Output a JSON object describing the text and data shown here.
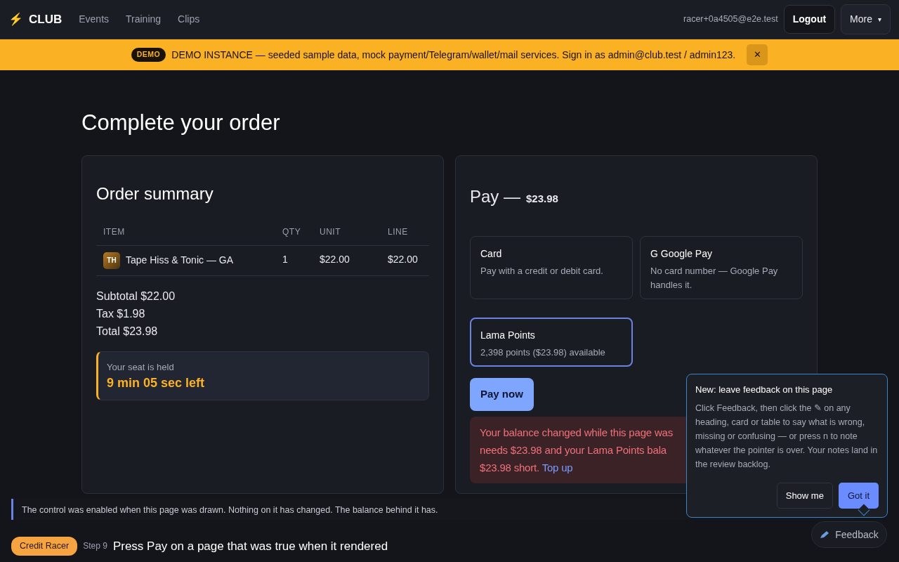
{
  "navbar": {
    "brand_icon": "⚡",
    "brand": "CLUB",
    "links": [
      {
        "label": "Events"
      },
      {
        "label": "Training"
      },
      {
        "label": "Clips"
      }
    ],
    "user": "racer+0a4505@e2e.test",
    "logout": "Logout",
    "more": "More",
    "more_caret": "▾"
  },
  "banner": {
    "badge": "DEMO",
    "text": "DEMO INSTANCE — seeded sample data, mock payment/Telegram/wallet/mail services. Sign in as admin@club.test / admin123.",
    "close": "✕"
  },
  "page_title": "Complete your order",
  "order": {
    "title": "Order summary",
    "columns": [
      "ITEM",
      "QTY",
      "UNIT",
      "LINE"
    ],
    "rows": [
      {
        "thumb": "TH",
        "item": "Tape Hiss & Tonic — GA",
        "qty": "1",
        "unit": "$22.00",
        "line": "$22.00"
      }
    ],
    "totals": [
      "Subtotal $22.00",
      "Tax $1.98",
      "Total $23.98"
    ],
    "hold": {
      "label": "Your seat is held",
      "time": "9 min 05 sec left"
    }
  },
  "pay": {
    "title": "Pay —",
    "amount": "$23.98",
    "methods": [
      {
        "name": "Card",
        "desc": "Pay with a credit or debit card.",
        "selected": false
      },
      {
        "name": "G Google Pay",
        "desc": "No card number — Google Pay handles it.",
        "selected": false
      },
      {
        "name": "Lama Points",
        "desc": "2,398 points ($23.98) available",
        "selected": true
      }
    ],
    "button": "Pay now",
    "error": {
      "lines": [
        "Your balance changed while this page was",
        "needs $23.98 and your Lama Points bala",
        "$23.98 short."
      ],
      "link": "Top up"
    }
  },
  "popover": {
    "title": "New: leave feedback on this page",
    "body": "Click Feedback, then click the ✎ on any heading, card or table to say what is wrong, missing or confusing — or press n to note whatever the pointer is over. Your notes land in the review backlog.",
    "secondary": "Show me",
    "primary": "Got it"
  },
  "hint": "The control was enabled when this page was drawn. Nothing on it has changed. The balance behind it has.",
  "step": {
    "badge": "Credit Racer",
    "step": "Step 9",
    "text": "Press Pay on a page that was true when it rendered"
  },
  "feedback_button": "Feedback"
}
